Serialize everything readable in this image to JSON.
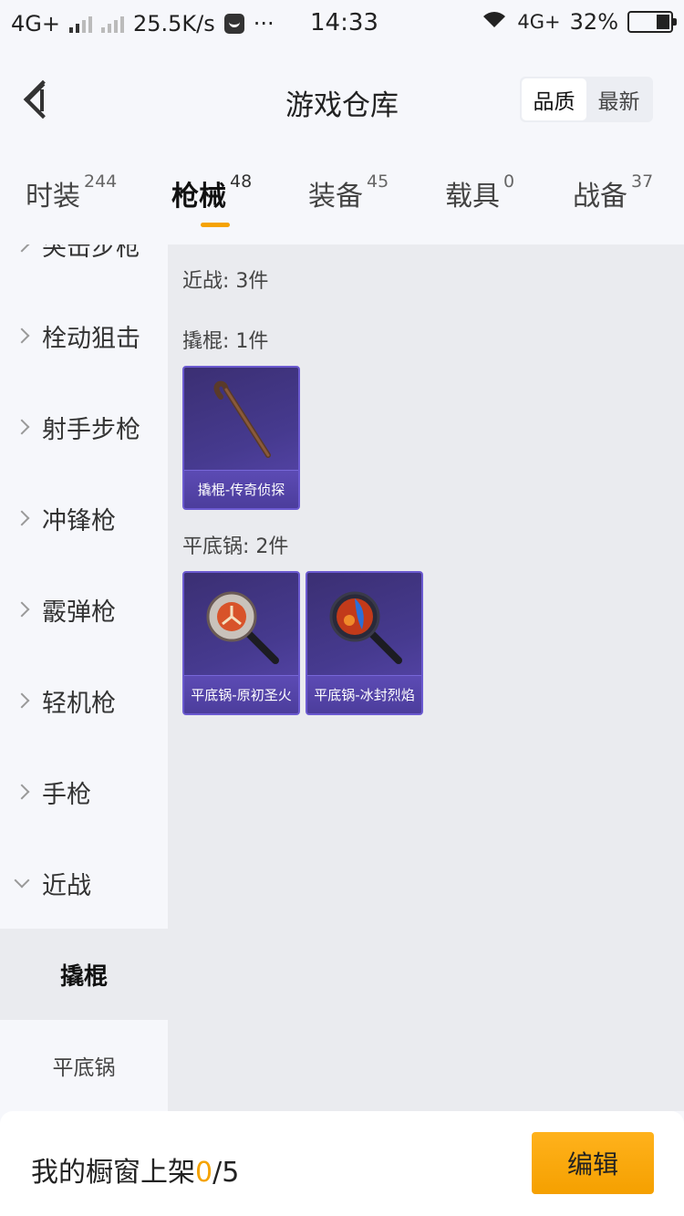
{
  "status_bar": {
    "network_left": "4G+",
    "speed": "25.5K/s",
    "more": "···",
    "time": "14:33",
    "network_right": "4G",
    "network_right_plus": "+",
    "battery": "32%"
  },
  "header": {
    "title": "游戏仓库",
    "sort_options": [
      "品质",
      "最新"
    ],
    "sort_selected": "品质"
  },
  "tabs": [
    {
      "label": "时装",
      "count": "244"
    },
    {
      "label": "枪械",
      "count": "48",
      "active": true
    },
    {
      "label": "装备",
      "count": "45"
    },
    {
      "label": "载具",
      "count": "0"
    },
    {
      "label": "战备",
      "count": "37"
    }
  ],
  "sidebar": {
    "categories": [
      "突击步枪",
      "栓动狙击",
      "射手步枪",
      "冲锋枪",
      "霰弹枪",
      "轻机枪",
      "手枪",
      "近战"
    ],
    "subcategories": [
      "撬棍",
      "平底锅"
    ],
    "selected_sub": "撬棍"
  },
  "content": {
    "section_title": "近战: 3件",
    "groups": [
      {
        "title": "撬棍: 1件",
        "items": [
          {
            "name": "撬棍-传奇侦探",
            "icon": "crowbar-icon"
          }
        ]
      },
      {
        "title": "平底锅: 2件",
        "items": [
          {
            "name": "平底锅-原初圣火",
            "icon": "frying-pan-icon"
          },
          {
            "name": "平底锅-冰封烈焰",
            "icon": "frying-pan-icon"
          }
        ]
      }
    ]
  },
  "bottom_bar": {
    "label": "我的橱窗上架",
    "current": "0",
    "total": "/5",
    "edit_label": "编辑"
  },
  "colors": {
    "accent": "#f5a300",
    "card_bg": "#463a8f",
    "page_bg": "#f6f7fb",
    "content_bg": "#eaebef"
  }
}
